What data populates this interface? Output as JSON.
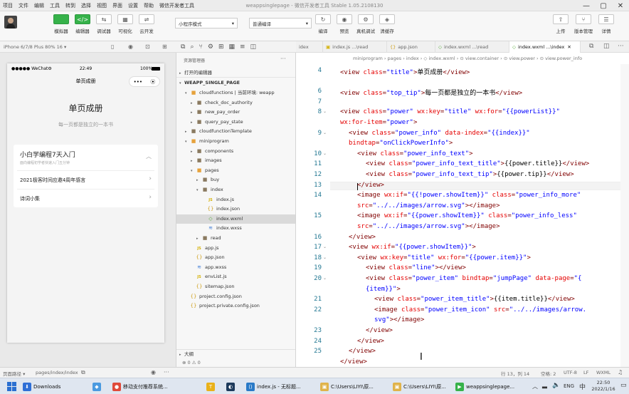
{
  "menubar": {
    "items": [
      "项目",
      "文件",
      "编辑",
      "工具",
      "转到",
      "选择",
      "视图",
      "界面",
      "设置",
      "帮助",
      "微信开发者工具"
    ],
    "title": "weappsinglepage - 微信开发者工具 Stable 1.05.2108130"
  },
  "toolbar": {
    "buttons": [
      {
        "icon": "",
        "label": "模拟器"
      },
      {
        "icon": "</>",
        "label": "编辑器"
      },
      {
        "icon": "⇆",
        "label": "调试器"
      },
      {
        "icon": "▦",
        "label": "可视化"
      },
      {
        "icon": "⇌",
        "label": "云开发"
      }
    ],
    "mode_select": "小程序模式",
    "compile_select": "普通编译",
    "right_buttons": [
      {
        "icon": "↻",
        "label": "编译"
      },
      {
        "icon": "◉",
        "label": "预览"
      },
      {
        "icon": "⚙",
        "label": "真机调试"
      },
      {
        "icon": "◈",
        "label": "清缓存"
      }
    ],
    "far_right": [
      {
        "icon": "⇧",
        "label": "上传"
      },
      {
        "icon": "⑂",
        "label": "版本管理"
      },
      {
        "icon": "☰",
        "label": "详情"
      }
    ]
  },
  "simulator": {
    "device_label": "iPhone 6/7/8 Plus 80% 16 ▾",
    "statusbar": {
      "carrier": "●●●●● WeChat⚙",
      "time": "22:49",
      "battery": "100%"
    },
    "nav_title": "单页成册",
    "page_title": "单页成册",
    "page_subtitle": "每一页都是独立的一本书",
    "items": [
      {
        "title": "小白学编程7天入门",
        "subtitle": "面向编程初学者快速入门五分钟"
      },
      {
        "title": "2021极客时间应邀4周年感言",
        "subtitle": ""
      },
      {
        "title": "诗词小集",
        "subtitle": ""
      }
    ]
  },
  "explorer": {
    "title": "资源管理器",
    "open_editors": "打开的编辑器",
    "project": "WEAPP_SINGLE_PAGE",
    "tree": [
      {
        "indent": 1,
        "arrow": "▾",
        "kind": "folder-open",
        "name": "cloudfunctions | 当前环境: weapp"
      },
      {
        "indent": 2,
        "arrow": "▸",
        "kind": "folder",
        "name": "check_doc_authority"
      },
      {
        "indent": 2,
        "arrow": "▸",
        "kind": "folder",
        "name": "new_pay_order"
      },
      {
        "indent": 2,
        "arrow": "▸",
        "kind": "folder",
        "name": "query_pay_state"
      },
      {
        "indent": 1,
        "arrow": "▸",
        "kind": "folder",
        "name": "cloudfunctionTemplate"
      },
      {
        "indent": 1,
        "arrow": "▾",
        "kind": "folder-open",
        "name": "miniprogram"
      },
      {
        "indent": 2,
        "arrow": "▸",
        "kind": "folder",
        "name": "components"
      },
      {
        "indent": 2,
        "arrow": "▸",
        "kind": "folder",
        "name": "images"
      },
      {
        "indent": 2,
        "arrow": "▾",
        "kind": "folder-open",
        "name": "pages"
      },
      {
        "indent": 3,
        "arrow": "▸",
        "kind": "folder",
        "name": "buy"
      },
      {
        "indent": 3,
        "arrow": "▾",
        "kind": "folder",
        "name": "index"
      },
      {
        "indent": 4,
        "arrow": "",
        "kind": "file-js",
        "name": "index.js"
      },
      {
        "indent": 4,
        "arrow": "",
        "kind": "file-json",
        "name": "index.json"
      },
      {
        "indent": 4,
        "arrow": "",
        "kind": "file-wxml",
        "name": "index.wxml",
        "selected": true
      },
      {
        "indent": 4,
        "arrow": "",
        "kind": "file-wxss",
        "name": "index.wxss"
      },
      {
        "indent": 3,
        "arrow": "▸",
        "kind": "folder",
        "name": "read"
      },
      {
        "indent": 2,
        "arrow": "",
        "kind": "file-js",
        "name": "app.js"
      },
      {
        "indent": 2,
        "arrow": "",
        "kind": "file-json",
        "name": "app.json"
      },
      {
        "indent": 2,
        "arrow": "",
        "kind": "file-wxss",
        "name": "app.wxss"
      },
      {
        "indent": 2,
        "arrow": "",
        "kind": "file-js",
        "name": "envList.js"
      },
      {
        "indent": 2,
        "arrow": "",
        "kind": "file-json",
        "name": "sitemap.json"
      },
      {
        "indent": 1,
        "arrow": "",
        "kind": "file-json",
        "name": "project.config.json"
      },
      {
        "indent": 1,
        "arrow": "",
        "kind": "file-json",
        "name": "project.private.config.json"
      }
    ],
    "outline": "大纲",
    "problems": "⊗ 0 ⚠ 0"
  },
  "editor": {
    "tabs": [
      {
        "name": "idex",
        "kind": "",
        "active": false
      },
      {
        "name": "index.js ...\\read",
        "kind": "file-js",
        "active": false
      },
      {
        "name": "app.json",
        "kind": "file-json",
        "active": false
      },
      {
        "name": "index.wxml ...\\read",
        "kind": "file-wxml",
        "active": false
      },
      {
        "name": "index.wxml ...\\index",
        "kind": "file-wxml",
        "active": true
      }
    ],
    "breadcrumb": "miniprogram › pages › index › ◇ index.wxml › ⊙ view.container › ⊙ view.power › ⊙ view.power_info",
    "lines": [
      {
        "n": "4",
        "fold": "",
        "indent": 0,
        "tokens": [
          [
            "tag",
            "<view "
          ],
          [
            "attr",
            "class"
          ],
          [
            "tag",
            "="
          ],
          [
            "str",
            "\"title\""
          ],
          [
            "tag",
            ">"
          ],
          [
            "txt",
            "单页成册"
          ],
          [
            "tag",
            "</view>"
          ]
        ]
      },
      {
        "n": "",
        "fold": "",
        "indent": 0,
        "tokens": []
      },
      {
        "n": "6",
        "fold": "",
        "indent": 0,
        "tokens": [
          [
            "tag",
            "<view "
          ],
          [
            "attr",
            "class"
          ],
          [
            "tag",
            "="
          ],
          [
            "str",
            "\"top_tip\""
          ],
          [
            "tag",
            ">"
          ],
          [
            "txt",
            "每一页都是独立的一本书"
          ],
          [
            "tag",
            "</view>"
          ]
        ]
      },
      {
        "n": "7",
        "fold": "",
        "indent": 0,
        "tokens": []
      },
      {
        "n": "8",
        "fold": "⌄",
        "indent": 0,
        "tokens": [
          [
            "tag",
            "<view "
          ],
          [
            "attr",
            "class"
          ],
          [
            "tag",
            "="
          ],
          [
            "str",
            "\"power\""
          ],
          [
            "attr",
            " wx:key"
          ],
          [
            "tag",
            "="
          ],
          [
            "str",
            "\"title\""
          ],
          [
            "attr",
            " wx:for"
          ],
          [
            "tag",
            "="
          ],
          [
            "str",
            "\"{{powerList}}\""
          ]
        ]
      },
      {
        "n": "",
        "fold": "",
        "indent": 0,
        "tokens": [
          [
            "attr",
            "wx:for-item"
          ],
          [
            "tag",
            "="
          ],
          [
            "str",
            "\"power\""
          ],
          [
            "tag",
            ">"
          ]
        ]
      },
      {
        "n": "9",
        "fold": "⌄",
        "indent": 1,
        "tokens": [
          [
            "tag",
            "<view "
          ],
          [
            "attr",
            "class"
          ],
          [
            "tag",
            "="
          ],
          [
            "str",
            "\"power_info\""
          ],
          [
            "attr",
            " data-index"
          ],
          [
            "tag",
            "="
          ],
          [
            "str",
            "\"{{index}}\""
          ]
        ]
      },
      {
        "n": "",
        "fold": "",
        "indent": 1,
        "tokens": [
          [
            "attr",
            "bindtap"
          ],
          [
            "tag",
            "="
          ],
          [
            "str",
            "\"onClickPowerInfo\""
          ],
          [
            "tag",
            ">"
          ]
        ]
      },
      {
        "n": "10",
        "fold": "⌄",
        "indent": 2,
        "tokens": [
          [
            "tag",
            "<view "
          ],
          [
            "attr",
            "class"
          ],
          [
            "tag",
            "="
          ],
          [
            "str",
            "\"power_info_text\""
          ],
          [
            "tag",
            ">"
          ]
        ]
      },
      {
        "n": "11",
        "fold": "",
        "indent": 3,
        "tokens": [
          [
            "tag",
            "<view "
          ],
          [
            "attr",
            "class"
          ],
          [
            "tag",
            "="
          ],
          [
            "str",
            "\"power_info_text_title\""
          ],
          [
            "tag",
            ">"
          ],
          [
            "txt",
            "{{power.title}}"
          ],
          [
            "tag",
            "</view>"
          ]
        ]
      },
      {
        "n": "12",
        "fold": "",
        "indent": 3,
        "tokens": [
          [
            "tag",
            "<view "
          ],
          [
            "attr",
            "class"
          ],
          [
            "tag",
            "="
          ],
          [
            "str",
            "\"power_info_text_tip\""
          ],
          [
            "tag",
            ">"
          ],
          [
            "txt",
            "{{power.tip}}"
          ],
          [
            "tag",
            "</view>"
          ]
        ]
      },
      {
        "n": "13",
        "fold": "",
        "indent": 2,
        "tokens": [
          [
            "tag",
            "</view>"
          ]
        ]
      },
      {
        "n": "14",
        "fold": "",
        "indent": 2,
        "tokens": [
          [
            "tag",
            "<image "
          ],
          [
            "attr",
            "wx:if"
          ],
          [
            "tag",
            "="
          ],
          [
            "str",
            "\"{{!power.showItem}}\""
          ],
          [
            "attr",
            " class"
          ],
          [
            "tag",
            "="
          ],
          [
            "str",
            "\"power_info_more\""
          ]
        ]
      },
      {
        "n": "",
        "fold": "",
        "indent": 2,
        "tokens": [
          [
            "attr",
            "src"
          ],
          [
            "tag",
            "="
          ],
          [
            "str",
            "\"../../images/arrow.svg\""
          ],
          [
            "tag",
            "></image>"
          ]
        ]
      },
      {
        "n": "15",
        "fold": "",
        "indent": 2,
        "tokens": [
          [
            "tag",
            "<image "
          ],
          [
            "attr",
            "wx:if"
          ],
          [
            "tag",
            "="
          ],
          [
            "str",
            "\"{{power.showItem}}\""
          ],
          [
            "attr",
            " class"
          ],
          [
            "tag",
            "="
          ],
          [
            "str",
            "\"power_info_less\""
          ]
        ]
      },
      {
        "n": "",
        "fold": "",
        "indent": 2,
        "tokens": [
          [
            "attr",
            "src"
          ],
          [
            "tag",
            "="
          ],
          [
            "str",
            "\"../../images/arrow.svg\""
          ],
          [
            "tag",
            "></image>"
          ]
        ]
      },
      {
        "n": "16",
        "fold": "",
        "indent": 1,
        "tokens": [
          [
            "tag",
            "</view>"
          ]
        ]
      },
      {
        "n": "17",
        "fold": "⌄",
        "indent": 1,
        "tokens": [
          [
            "tag",
            "<view "
          ],
          [
            "attr",
            "wx:if"
          ],
          [
            "tag",
            "="
          ],
          [
            "str",
            "\"{{power.showItem}}\""
          ],
          [
            "tag",
            ">"
          ]
        ]
      },
      {
        "n": "18",
        "fold": "⌄",
        "indent": 2,
        "tokens": [
          [
            "tag",
            "<view "
          ],
          [
            "attr",
            "wx:key"
          ],
          [
            "tag",
            "="
          ],
          [
            "str",
            "\"title\""
          ],
          [
            "attr",
            " wx:for"
          ],
          [
            "tag",
            "="
          ],
          [
            "str",
            "\"{{power.item}}\""
          ],
          [
            "tag",
            ">"
          ]
        ]
      },
      {
        "n": "19",
        "fold": "",
        "indent": 3,
        "tokens": [
          [
            "tag",
            "<view "
          ],
          [
            "attr",
            "class"
          ],
          [
            "tag",
            "="
          ],
          [
            "str",
            "\"line\""
          ],
          [
            "tag",
            "></view>"
          ]
        ]
      },
      {
        "n": "20",
        "fold": "⌄",
        "indent": 3,
        "tokens": [
          [
            "tag",
            "<view "
          ],
          [
            "attr",
            "class"
          ],
          [
            "tag",
            "="
          ],
          [
            "str",
            "\"power_item\""
          ],
          [
            "attr",
            " bindtap"
          ],
          [
            "tag",
            "="
          ],
          [
            "str",
            "\"jumpPage\""
          ],
          [
            "attr",
            " data-page"
          ],
          [
            "tag",
            "="
          ],
          [
            "str",
            "\"{"
          ]
        ]
      },
      {
        "n": "",
        "fold": "",
        "indent": 3,
        "tokens": [
          [
            "str",
            "{item}}\""
          ],
          [
            "tag",
            ">"
          ]
        ]
      },
      {
        "n": "21",
        "fold": "",
        "indent": 4,
        "tokens": [
          [
            "tag",
            "<view "
          ],
          [
            "attr",
            "class"
          ],
          [
            "tag",
            "="
          ],
          [
            "str",
            "\"power_item_title\""
          ],
          [
            "tag",
            ">"
          ],
          [
            "txt",
            "{{item.title}}"
          ],
          [
            "tag",
            "</view>"
          ]
        ]
      },
      {
        "n": "22",
        "fold": "",
        "indent": 4,
        "tokens": [
          [
            "tag",
            "<image "
          ],
          [
            "attr",
            "class"
          ],
          [
            "tag",
            "="
          ],
          [
            "str",
            "\"power_item_icon\""
          ],
          [
            "attr",
            " src"
          ],
          [
            "tag",
            "="
          ],
          [
            "str",
            "\"../../images/arrow."
          ]
        ]
      },
      {
        "n": "",
        "fold": "",
        "indent": 4,
        "tokens": [
          [
            "str",
            "svg\""
          ],
          [
            "tag",
            "></image>"
          ]
        ]
      },
      {
        "n": "23",
        "fold": "",
        "indent": 3,
        "tokens": [
          [
            "tag",
            "</view>"
          ]
        ]
      },
      {
        "n": "24",
        "fold": "",
        "indent": 2,
        "tokens": [
          [
            "tag",
            "</view>"
          ]
        ]
      },
      {
        "n": "25",
        "fold": "",
        "indent": 1,
        "tokens": [
          [
            "tag",
            "</view>"
          ]
        ]
      },
      {
        "n": "",
        "fold": "",
        "indent": 0,
        "tokens": [
          [
            "tag",
            "</view>"
          ]
        ]
      }
    ]
  },
  "statusbar": {
    "page_path_label": "页面路径 ▾",
    "page_path": "pages/index/index",
    "cursor": "行 13，列 14",
    "spaces": "空格: 2",
    "encoding": "UTF-8",
    "eol": "LF",
    "lang": "WXML"
  },
  "taskbar": {
    "items": [
      {
        "label": "Downloads",
        "color": "#2f6fd6",
        "icon": "⬇"
      },
      {
        "label": "",
        "color": "#4a9ae0",
        "icon": "◆"
      },
      {
        "label": "移动支付推荐系统...",
        "color": "#e04a3a",
        "icon": "●"
      },
      {
        "label": "",
        "color": "#e9b11a",
        "icon": "T"
      },
      {
        "label": "",
        "color": "#1d3a5c",
        "icon": "◐"
      },
      {
        "label": "index.js - 无标题...",
        "color": "#2a7ac7",
        "icon": "⟨⟩"
      },
      {
        "label": "C:\\Users\\LIYI\\原...",
        "color": "#e0b34a",
        "icon": "▣"
      },
      {
        "label": "C:\\Users\\LIYI\\原...",
        "color": "#e0b34a",
        "icon": "▣"
      },
      {
        "label": "weappsinglepage...",
        "color": "#36b24a",
        "icon": "▶"
      }
    ],
    "lang": "ENG",
    "time": "22:50",
    "date": "2022/1/16"
  }
}
